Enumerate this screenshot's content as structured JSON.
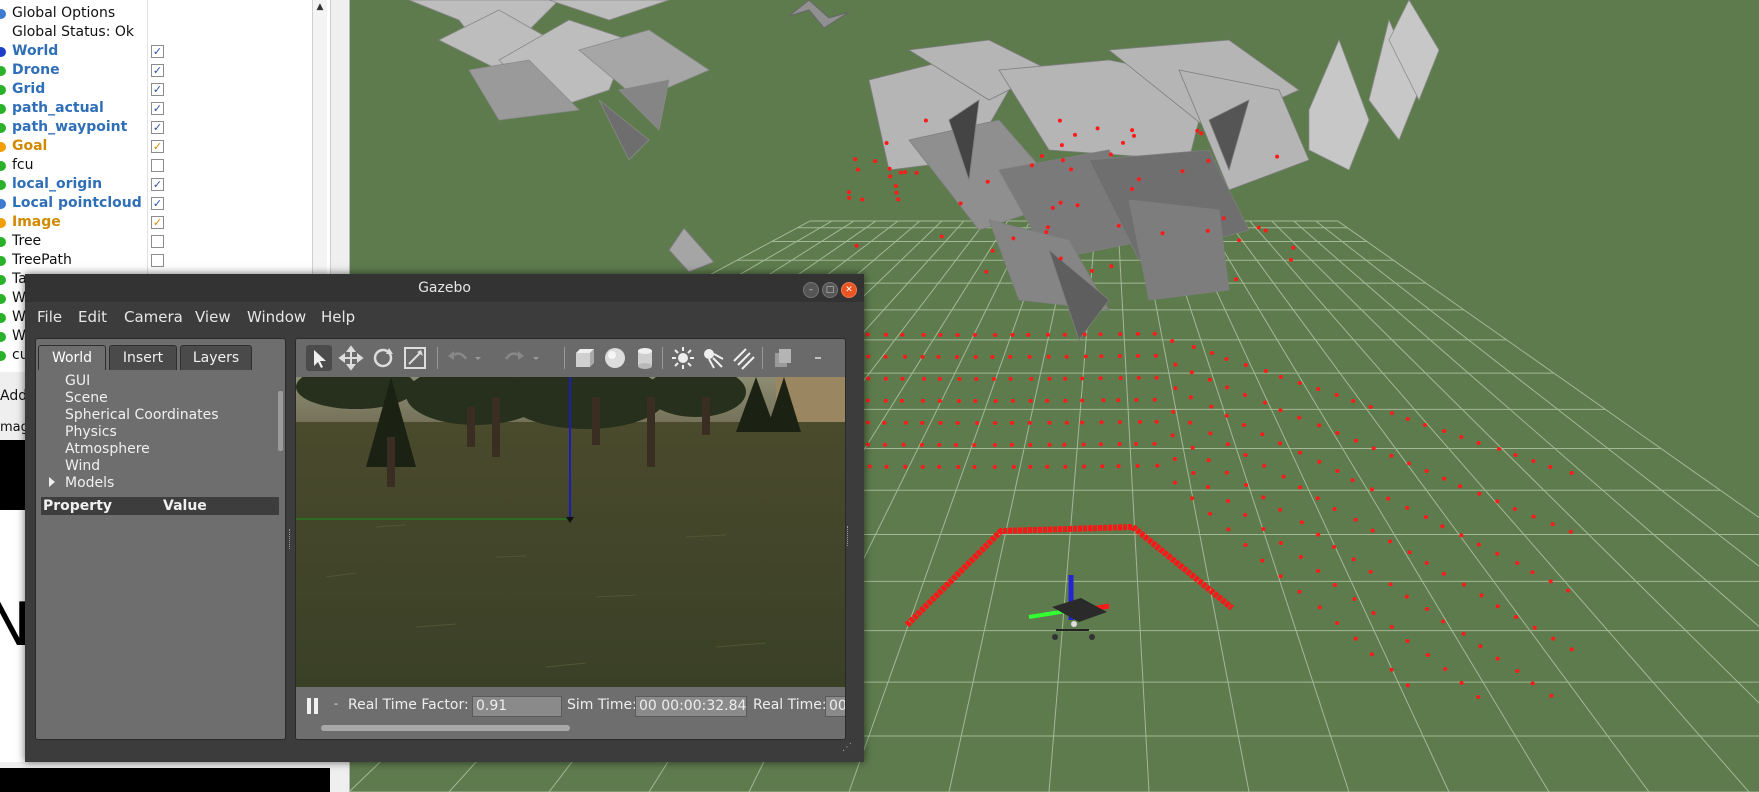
{
  "rviz": {
    "displays": [
      {
        "name": "Global Options",
        "style": "plain",
        "icon_color": "#3c7bd1",
        "checkbox": false
      },
      {
        "name": "Global Status: Ok",
        "style": "plain",
        "icon_color": "",
        "checkbox": false
      },
      {
        "name": "World",
        "style": "enabled",
        "icon_color": "#1f3fc8",
        "checkbox": true,
        "checked": true
      },
      {
        "name": "Drone",
        "style": "enabled",
        "icon_color": "#2ab12a",
        "checkbox": true,
        "checked": true
      },
      {
        "name": "Grid",
        "style": "enabled",
        "icon_color": "#2ab12a",
        "checkbox": true,
        "checked": true
      },
      {
        "name": "path_actual",
        "style": "enabled",
        "icon_color": "#2ab12a",
        "checkbox": true,
        "checked": true
      },
      {
        "name": "path_waypoint",
        "style": "enabled",
        "icon_color": "#2ab12a",
        "checkbox": true,
        "checked": true
      },
      {
        "name": "Goal",
        "style": "warn",
        "icon_color": "#f29d00",
        "checkbox": true,
        "checked": true
      },
      {
        "name": "fcu",
        "style": "plain",
        "icon_color": "#2ab12a",
        "checkbox": true,
        "checked": false
      },
      {
        "name": "local_origin",
        "style": "enabled",
        "icon_color": "#2ab12a",
        "checkbox": true,
        "checked": true
      },
      {
        "name": "Local pointcloud",
        "style": "enabled",
        "icon_color": "#3c7bd1",
        "checkbox": true,
        "checked": true
      },
      {
        "name": "Image",
        "style": "warn",
        "icon_color": "#f29d00",
        "checkbox": true,
        "checked": true
      },
      {
        "name": "Tree",
        "style": "plain",
        "icon_color": "#2ab12a",
        "checkbox": true,
        "checked": false
      },
      {
        "name": "TreePath",
        "style": "plain",
        "icon_color": "#2ab12a",
        "checkbox": true,
        "checked": false
      },
      {
        "name": "Ta",
        "style": "plain",
        "icon_color": "#2ab12a",
        "checkbox": false
      },
      {
        "name": "W",
        "style": "plain",
        "icon_color": "#2ab12a",
        "checkbox": false
      },
      {
        "name": "W",
        "style": "plain",
        "icon_color": "#2ab12a",
        "checkbox": false
      },
      {
        "name": "W",
        "style": "plain",
        "icon_color": "#2ab12a",
        "checkbox": false
      },
      {
        "name": "cu",
        "style": "plain",
        "icon_color": "#2ab12a",
        "checkbox": false
      }
    ],
    "add_button": "Add",
    "image_panel_title": "mag",
    "image_letter": "N"
  },
  "gazebo": {
    "title": "Gazebo",
    "menu": [
      "File",
      "Edit",
      "Camera",
      "View",
      "Window",
      "Help"
    ],
    "tabs": [
      "World",
      "Insert",
      "Layers"
    ],
    "world_items": [
      "GUI",
      "Scene",
      "Spherical Coordinates",
      "Physics",
      "Atmosphere",
      "Wind",
      "Models"
    ],
    "property_header": "Property",
    "value_header": "Value",
    "real_time_factor_label": "Real Time Factor:",
    "real_time_factor": "0.91",
    "sim_time_label": "Sim Time:",
    "sim_time": "00 00:00:32.844",
    "real_time_label": "Real Time:",
    "real_time": "00",
    "step_label": "-"
  },
  "colors": {
    "rviz_background": "#5d7b4d",
    "grid": "#9fb693",
    "pointcloud": "#ff1a1a",
    "gazebo_chrome": "#3c3c3c",
    "accent_close": "#e95420"
  }
}
